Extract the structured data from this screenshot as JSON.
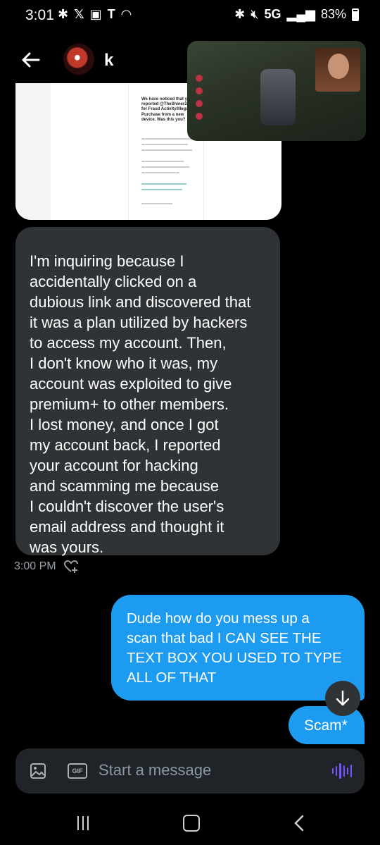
{
  "status": {
    "time": "3:01",
    "network": "5G",
    "battery": "83%"
  },
  "header": {
    "username": "k"
  },
  "attachment": {
    "doc_title": "We have noticed that you reported @TheShiner2126 for Fraud Activity/Illegal Purchase from a new device. Was this you?"
  },
  "messages": {
    "incoming": {
      "lines": [
        "I'm inquiring because I",
        "accidentally clicked on a",
        "dubious link and discovered that",
        "it was a plan utilized by hackers",
        "to access my account. Then,",
        "I don't know who it was, my",
        "account was exploited to give",
        "premium+ to other members.",
        "I lost money, and once I got",
        "my account back, I reported",
        "your account for hacking",
        "and scamming me because",
        "I couldn't discover the user's",
        "email address and thought it",
        "was yours."
      ],
      "time": "3:00 PM"
    },
    "outgoing": {
      "lines": [
        "Dude how do you mess up a",
        "scan that bad I CAN SEE THE",
        "TEXT BOX YOU USED TO TYPE",
        "ALL OF THAT"
      ],
      "second": "Scam*"
    }
  },
  "composer": {
    "placeholder": "Start a message",
    "gif_label": "GIF"
  },
  "icons": {
    "back": "arrow-left-icon",
    "react": "heart-plus-icon",
    "image": "image-icon",
    "voice": "voice-waveform-icon",
    "scroll": "arrow-down-icon"
  },
  "colors": {
    "accent": "#1d9bf0",
    "incoming_bubble": "#2f3336",
    "composer": "#202327",
    "voice": "#7856ff"
  }
}
